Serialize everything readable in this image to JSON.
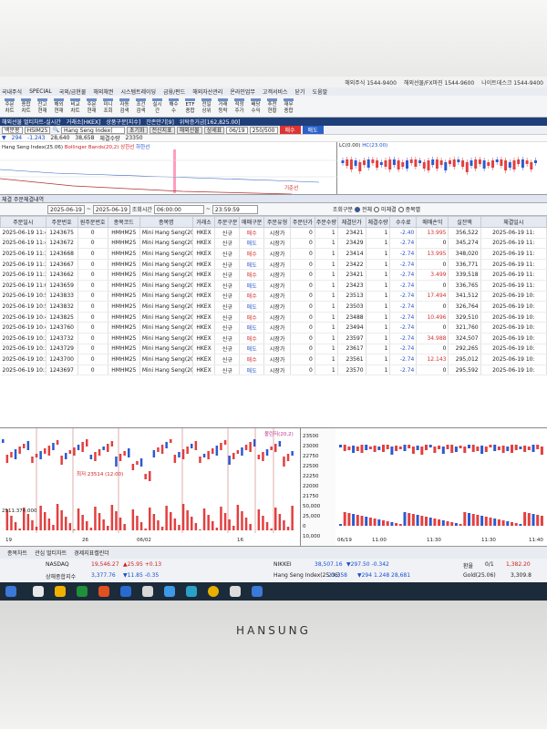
{
  "top_info": [
    "해외주식 1544-9400",
    "해외선물/FX마진 1544-9600",
    "나이트데스크 1544-9400"
  ],
  "menu": [
    "국내주식",
    "SPECIAL",
    "국외/금현물",
    "해외채권",
    "시스템트레이딩",
    "금융/펀드",
    "해외자산관리",
    "온라인업무",
    "고객서비스",
    "닫기",
    "도움말"
  ],
  "toolbar": [
    {
      "top": "주문",
      "bottom": "차트"
    },
    {
      "top": "종합",
      "bottom": "차트"
    },
    {
      "top": "잔고",
      "bottom": "현재"
    },
    {
      "top": "해외",
      "bottom": "현재"
    },
    {
      "top": "비교",
      "bottom": "차트"
    },
    {
      "top": "주문",
      "bottom": "현재"
    },
    {
      "top": "미니",
      "bottom": "조회"
    },
    {
      "top": "자동",
      "bottom": "검색"
    },
    {
      "top": "조건",
      "bottom": "검색"
    },
    {
      "top": "실시",
      "bottom": "간"
    },
    {
      "top": "해수",
      "bottom": "수"
    },
    {
      "top": "ETF",
      "bottom": "종합"
    },
    {
      "top": "전일",
      "bottom": "상위"
    },
    {
      "top": "거래",
      "bottom": "등락"
    },
    {
      "top": "적정",
      "bottom": "주가"
    },
    {
      "top": "배당",
      "bottom": "수익"
    },
    {
      "top": "추천",
      "bottom": "현황"
    },
    {
      "top": "재무",
      "bottom": "종합"
    }
  ],
  "app_title": [
    "해외선물 멀티차트-실시간",
    "거래소[HKEX]",
    "상품구분[지수]",
    "잔존만기[9]",
    "위탁증거금[162,825.00]"
  ],
  "controls": {
    "account": "백분봉",
    "symbol": "HSIM25",
    "symbol_name": "Hang Seng Index(",
    "order_buy": "매수",
    "order_sell": "매도",
    "date": "06/19",
    "count": "250/500",
    "buttons": [
      "초기화",
      "전신지표",
      "해외선물",
      "상세표"
    ]
  },
  "quote_line": {
    "prefix": "▼",
    "change1": "294",
    "change2": "-1.243",
    "price": "28,640",
    "vol": "38,658",
    "label": "체결수량",
    "last": "23350"
  },
  "left_chart": {
    "legend": [
      "Hang Seng Index(25.06)",
      "Bollinger Bands(20,2)",
      "상한선",
      "하한선"
    ],
    "labels": [
      "23,600",
      "23,400",
      "23,200",
      "23,000"
    ],
    "note": "기준선"
  },
  "right_chart": {
    "legend": [
      "LC(0.00)",
      "HC(23.00)"
    ],
    "labels": [
      "24000",
      "23000"
    ]
  },
  "tab_label": "체결 주문체결내역",
  "filters": {
    "date_from": "2025-06-19",
    "date_to": "2025-06-19",
    "time_label": "조회시간",
    "time_from": "06:00:00",
    "time_to": "23:59:59",
    "kind_label": "조회구분",
    "radio_all": "전체",
    "radio_unfilled": "미체결",
    "radio_item": "종목별"
  },
  "table": {
    "headers": [
      "주문일시",
      "주문번호",
      "원주문번호",
      "종목코드",
      "종목명",
      "거래소",
      "주문구분",
      "매매구분",
      "주문유형",
      "주문단가",
      "주문수량",
      "체결단가",
      "체결수량",
      "수수료",
      "매매손익",
      "실잔액",
      "체결일시"
    ],
    "rows": [
      [
        "2025-06-19 11:4",
        "1243675",
        "0",
        "HMHM25",
        "Mini Hang Seng(202",
        "HKEX",
        "신규",
        "매수",
        "시장가",
        "0",
        "1",
        "23421",
        "1",
        "-2.40",
        "13.995",
        "356,522",
        "2025-06-19 11:"
      ],
      [
        "2025-06-19 11:4",
        "1243672",
        "0",
        "HMHM25",
        "Mini Hang Seng(202",
        "HKEX",
        "신규",
        "매도",
        "시장가",
        "0",
        "1",
        "23429",
        "1",
        "-2.74",
        "0",
        "345,274",
        "2025-06-19 11:"
      ],
      [
        "2025-06-19 11:3",
        "1243668",
        "0",
        "HMHM25",
        "Mini Hang Seng(202",
        "HKEX",
        "신규",
        "매수",
        "시장가",
        "0",
        "1",
        "23414",
        "1",
        "-2.74",
        "13.995",
        "348,020",
        "2025-06-19 11:"
      ],
      [
        "2025-06-19 11:3",
        "1243667",
        "0",
        "HMHM25",
        "Mini Hang Seng(202",
        "HKEX",
        "신규",
        "매도",
        "시장가",
        "0",
        "1",
        "23422",
        "1",
        "-2.74",
        "0",
        "336,771",
        "2025-06-19 11:"
      ],
      [
        "2025-06-19 11:3",
        "1243662",
        "0",
        "HMHM25",
        "Mini Hang Seng(202",
        "HKEX",
        "신규",
        "매수",
        "시장가",
        "0",
        "1",
        "23421",
        "1",
        "-2.74",
        "3.499",
        "339,518",
        "2025-06-19 11:"
      ],
      [
        "2025-06-19 11:0",
        "1243659",
        "0",
        "HMHM25",
        "Mini Hang Seng(202",
        "HKEX",
        "신규",
        "매도",
        "시장가",
        "0",
        "1",
        "23423",
        "1",
        "-2.74",
        "0",
        "336,765",
        "2025-06-19 11:"
      ],
      [
        "2025-06-19 10:5",
        "1243833",
        "0",
        "HMHM25",
        "Mini Hang Seng(202",
        "HKEX",
        "신규",
        "매수",
        "시장가",
        "0",
        "1",
        "23513",
        "1",
        "-2.74",
        "17.494",
        "341,512",
        "2025-06-19 10:"
      ],
      [
        "2025-06-19 10:5",
        "1243832",
        "0",
        "HMHM25",
        "Mini Hang Seng(202",
        "HKEX",
        "신규",
        "매도",
        "시장가",
        "0",
        "1",
        "23503",
        "1",
        "-2.74",
        "0",
        "326,764",
        "2025-06-19 10:"
      ],
      [
        "2025-06-19 10:4",
        "1243825",
        "0",
        "HMHM25",
        "Mini Hang Seng(202",
        "HKEX",
        "신규",
        "매수",
        "시장가",
        "0",
        "1",
        "23488",
        "1",
        "-2.74",
        "10.496",
        "329,510",
        "2025-06-19 10:"
      ],
      [
        "2025-06-19 10:4",
        "1243760",
        "0",
        "HMHM25",
        "Mini Hang Seng(202",
        "HKEX",
        "신규",
        "매도",
        "시장가",
        "0",
        "1",
        "23494",
        "1",
        "-2.74",
        "0",
        "321,760",
        "2025-06-19 10:"
      ],
      [
        "2025-06-19 10:3",
        "1243732",
        "0",
        "HMHM25",
        "Mini Hang Seng(202",
        "HKEX",
        "신규",
        "매수",
        "시장가",
        "0",
        "1",
        "23597",
        "1",
        "-2.74",
        "34.988",
        "324,507",
        "2025-06-19 10:"
      ],
      [
        "2025-06-19 10:3",
        "1243729",
        "0",
        "HMHM25",
        "Mini Hang Seng(202",
        "HKEX",
        "신규",
        "매도",
        "시장가",
        "0",
        "1",
        "23617",
        "1",
        "-2.74",
        "0",
        "292,265",
        "2025-06-19 10:"
      ],
      [
        "2025-06-19 10:1",
        "1243700",
        "0",
        "HMHM25",
        "Mini Hang Seng(202",
        "HKEX",
        "신규",
        "매수",
        "시장가",
        "0",
        "1",
        "23561",
        "1",
        "-2.74",
        "12.143",
        "295,012",
        "2025-06-19 10:"
      ],
      [
        "2025-06-19 10:1",
        "1243697",
        "0",
        "HMHM25",
        "Mini Hang Seng(202",
        "HKEX",
        "신규",
        "매도",
        "시장가",
        "0",
        "1",
        "23570",
        "1",
        "-2.74",
        "0",
        "295,592",
        "2025-06-19 10:"
      ]
    ]
  },
  "bottom_left_chart": {
    "labels": [
      "23,500",
      "23,000",
      "22,500"
    ],
    "note": "최저 23514 (12:00)",
    "x_ticks": [
      "19",
      "26",
      "06/02",
      "16"
    ],
    "volume_label": "2511.374,000"
  },
  "bottom_mid_scale": [
    "23500",
    "23000",
    "22750",
    "22500",
    "22250",
    "22000",
    "21750",
    "50,000",
    "25,000",
    "0",
    "10,000"
  ],
  "bottom_mid_label": "볼린저(20,2)",
  "bottom_right_chart": {
    "x_ticks": [
      "06/19",
      "11:00",
      "11:30",
      "11:30",
      "11:40"
    ]
  },
  "bottom_tabs": [
    "종목차트",
    "관심 멀티차트",
    "경제지표캘린더"
  ],
  "ticker": {
    "r1c1_name": "NASDAQ",
    "r1c1_val": "19,546.27",
    "r1c1_chg": "▲25.95  +0.13",
    "r2c1_name": "상해종합지수",
    "r2c1_val": "3,377.76",
    "r2c1_chg": "▼11.85  -0.35",
    "r1c2_name": "NIKKEI",
    "r1c2_val": "38,507.16",
    "r1c2_chg": "▼297.50  -0.342",
    "r2c2_name": "Hang Seng Index(25.06)",
    "r2c2_val": "23,358",
    "r2c2_chg": "▼294  1.248  28,681",
    "r1c3_name": "환율",
    "r1c3_val": "1,382.20",
    "r2c3_name": "Gold(25.06)",
    "r2c3_val": "3,309.8",
    "r1c3_extra": "0/1"
  },
  "monitor_brand": "HANSUNG"
}
